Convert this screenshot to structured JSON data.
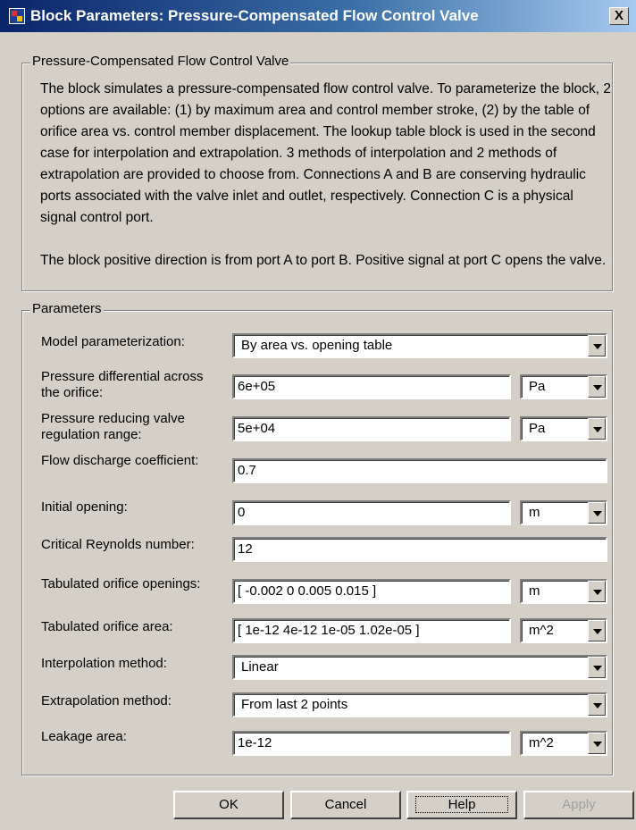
{
  "window": {
    "title": "Block Parameters: Pressure-Compensated Flow Control Valve",
    "close_label": "X"
  },
  "description": {
    "legend": "Pressure-Compensated Flow Control Valve",
    "paragraph1": "The block simulates a pressure-compensated flow control valve. To parameterize the block, 2 options are available: (1) by maximum area and control member stroke, (2) by the table of orifice area vs. control member displacement. The lookup table block is used in the second case for interpolation and extrapolation. 3 methods of interpolation and 2 methods of extrapolation are provided to choose from. Connections A and B are conserving hydraulic ports associated with the valve inlet and outlet, respectively. Connection C is a physical signal control port.",
    "paragraph2": "The block positive direction is from port A to port B. Positive signal at port C opens the valve."
  },
  "parameters": {
    "legend": "Parameters",
    "model_parameterization": {
      "label": "Model parameterization:",
      "value": "By area vs. opening table"
    },
    "pressure_differential": {
      "label_line1": "Pressure differential across",
      "label_line2": "the orifice:",
      "value": "6e+05",
      "unit": "Pa"
    },
    "regulation_range": {
      "label_line1": "Pressure reducing valve",
      "label_line2": "regulation range:",
      "value": "5e+04",
      "unit": "Pa"
    },
    "discharge_coefficient": {
      "label": "Flow discharge coefficient:",
      "value": "0.7"
    },
    "initial_opening": {
      "label": "Initial opening:",
      "value": "0",
      "unit": "m"
    },
    "critical_reynolds": {
      "label": "Critical Reynolds number:",
      "value": "12"
    },
    "tabulated_openings": {
      "label": "Tabulated orifice openings:",
      "value": "[ -0.002 0 0.005 0.015 ]",
      "unit": "m"
    },
    "tabulated_area": {
      "label": "Tabulated orifice area:",
      "value": "[ 1e-12 4e-12 1e-05 1.02e-05 ]",
      "unit": "m^2"
    },
    "interpolation": {
      "label": "Interpolation method:",
      "value": "Linear"
    },
    "extrapolation": {
      "label": "Extrapolation method:",
      "value": "From last 2 points"
    },
    "leakage_area": {
      "label": "Leakage area:",
      "value": "1e-12",
      "unit": "m^2"
    }
  },
  "buttons": {
    "ok": "OK",
    "cancel": "Cancel",
    "help": "Help",
    "apply": "Apply"
  }
}
